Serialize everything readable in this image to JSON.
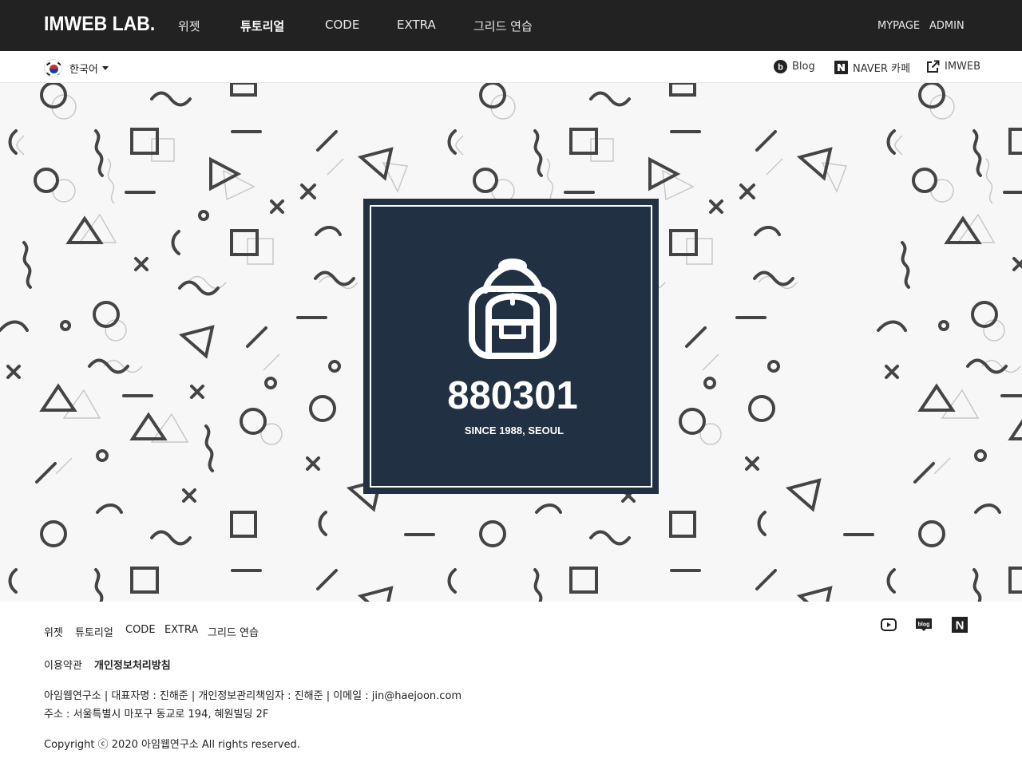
{
  "header": {
    "logo": "IMWEB LAB.",
    "nav": [
      {
        "label": "위젯",
        "active": false
      },
      {
        "label": "튜토리얼",
        "active": true
      },
      {
        "label": "CODE",
        "active": false
      },
      {
        "label": "EXTRA",
        "active": false
      },
      {
        "label": "그리드 연습",
        "active": false
      }
    ],
    "user_links": [
      "MYPAGE",
      "ADMIN"
    ],
    "background": "#222222"
  },
  "subbar": {
    "language": {
      "label": "한국어",
      "icon": "korea-flag-icon"
    },
    "links": [
      {
        "label": "Blog",
        "icon": "blog-b-icon"
      },
      {
        "label": "NAVER 카페",
        "icon": "naver-n-icon"
      },
      {
        "label": "IMWEB",
        "icon": "external-link-icon"
      }
    ]
  },
  "hero": {
    "badge_number": "880301",
    "badge_subtitle": "SINCE 1988, SEOUL",
    "badge_icon": "backpack-icon",
    "badge_color": "#223044",
    "pattern_background": "#f7f7f7"
  },
  "footer": {
    "nav": [
      "위젯",
      "튜토리얼",
      "CODE",
      "EXTRA",
      "그리드 연습"
    ],
    "policy": [
      "이용약관",
      "개인정보처리방침"
    ],
    "info_line1": "아임웹연구소 | 대표자명 : 진해준 | 개인정보관리책임자 : 진해준 | 이메일 : jin@haejoon.com",
    "info_line2": "주소 : 서울특별시 마포구 동교로 194, 혜원빌딩 2F",
    "copyright": "Copyright ⓒ 2020 아임웹연구소 All rights reserved.",
    "social": [
      {
        "icon": "youtube-icon"
      },
      {
        "icon": "naver-blog-icon",
        "text": "blog"
      },
      {
        "icon": "naver-icon",
        "text": "N"
      }
    ]
  }
}
